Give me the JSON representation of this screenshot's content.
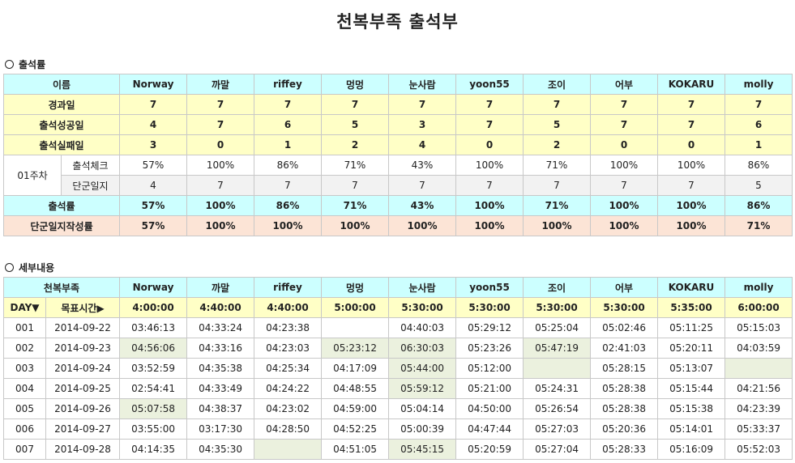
{
  "title": "천복부족 출석부",
  "section1": {
    "label": "출석률",
    "header_label": "이름",
    "names": [
      "Norway",
      "까말",
      "riffey",
      "멍멍",
      "눈사람",
      "yoon55",
      "조이",
      "어부",
      "KOKARU",
      "molly"
    ],
    "rows": [
      {
        "label": "경과일",
        "values": [
          "7",
          "7",
          "7",
          "7",
          "7",
          "7",
          "7",
          "7",
          "7",
          "7"
        ]
      },
      {
        "label": "출석성공일",
        "values": [
          "4",
          "7",
          "6",
          "5",
          "3",
          "7",
          "5",
          "7",
          "7",
          "6"
        ]
      },
      {
        "label": "출석실패일",
        "values": [
          "3",
          "0",
          "1",
          "2",
          "4",
          "0",
          "2",
          "0",
          "0",
          "1"
        ]
      }
    ],
    "week": {
      "label": "01주차",
      "check_label": "출석체크",
      "check_values": [
        "57%",
        "100%",
        "86%",
        "71%",
        "43%",
        "100%",
        "71%",
        "100%",
        "100%",
        "86%"
      ],
      "journal_label": "단군일지",
      "journal_values": [
        "4",
        "7",
        "7",
        "7",
        "7",
        "7",
        "7",
        "7",
        "7",
        "5"
      ]
    },
    "rate": {
      "label": "출석률",
      "values": [
        "57%",
        "100%",
        "86%",
        "71%",
        "43%",
        "100%",
        "71%",
        "100%",
        "100%",
        "86%"
      ]
    },
    "journal_rate": {
      "label": "단군일지작성률",
      "values": [
        "57%",
        "100%",
        "100%",
        "100%",
        "100%",
        "100%",
        "100%",
        "100%",
        "100%",
        "71%"
      ]
    }
  },
  "section2": {
    "label": "세부내용",
    "header_label": "천복부족",
    "names": [
      "Norway",
      "까말",
      "riffey",
      "멍멍",
      "눈사람",
      "yoon55",
      "조이",
      "어부",
      "KOKARU",
      "molly"
    ],
    "day_label": "DAY▼",
    "target_label": "목표시간▶",
    "targets": [
      "4:00:00",
      "4:40:00",
      "4:40:00",
      "5:00:00",
      "5:30:00",
      "5:30:00",
      "5:30:00",
      "5:30:00",
      "5:35:00",
      "6:00:00"
    ],
    "rows": [
      {
        "day": "001",
        "date": "2014-09-22",
        "times": [
          "03:46:13",
          "04:33:24",
          "04:23:38",
          "",
          "04:40:03",
          "05:29:12",
          "05:25:04",
          "05:02:46",
          "05:11:25",
          "05:15:03"
        ]
      },
      {
        "day": "002",
        "date": "2014-09-23",
        "times": [
          "04:56:06",
          "04:33:16",
          "04:23:03",
          "05:23:12",
          "06:30:03",
          "05:23:26",
          "05:47:19",
          "02:41:03",
          "05:20:11",
          "04:03:59"
        ]
      },
      {
        "day": "003",
        "date": "2014-09-24",
        "times": [
          "03:52:59",
          "04:35:38",
          "04:25:34",
          "04:17:09",
          "05:44:00",
          "05:12:00",
          "",
          "05:28:15",
          "05:13:07",
          ""
        ]
      },
      {
        "day": "004",
        "date": "2014-09-25",
        "times": [
          "02:54:41",
          "04:33:49",
          "04:24:22",
          "04:48:55",
          "05:59:12",
          "05:21:00",
          "05:24:31",
          "05:28:38",
          "05:15:44",
          "04:21:56"
        ]
      },
      {
        "day": "005",
        "date": "2014-09-26",
        "times": [
          "05:07:58",
          "04:38:37",
          "04:23:02",
          "04:59:00",
          "05:04:14",
          "04:50:00",
          "05:26:54",
          "05:28:38",
          "05:15:38",
          "04:23:39"
        ]
      },
      {
        "day": "006",
        "date": "2014-09-27",
        "times": [
          "03:55:00",
          "03:17:30",
          "04:28:50",
          "04:52:25",
          "05:00:39",
          "04:47:44",
          "05:27:03",
          "05:20:36",
          "05:14:01",
          "05:33:37"
        ]
      },
      {
        "day": "007",
        "date": "2014-09-28",
        "times": [
          "04:14:35",
          "04:35:30",
          "",
          "04:51:05",
          "05:45:15",
          "05:20:59",
          "05:27:04",
          "05:28:33",
          "05:16:09",
          "05:52:03"
        ]
      }
    ],
    "highlights": [
      [],
      [
        0,
        3,
        4,
        6
      ],
      [
        4,
        6,
        9
      ],
      [
        4
      ],
      [
        0
      ],
      [],
      [
        2,
        4
      ]
    ]
  }
}
